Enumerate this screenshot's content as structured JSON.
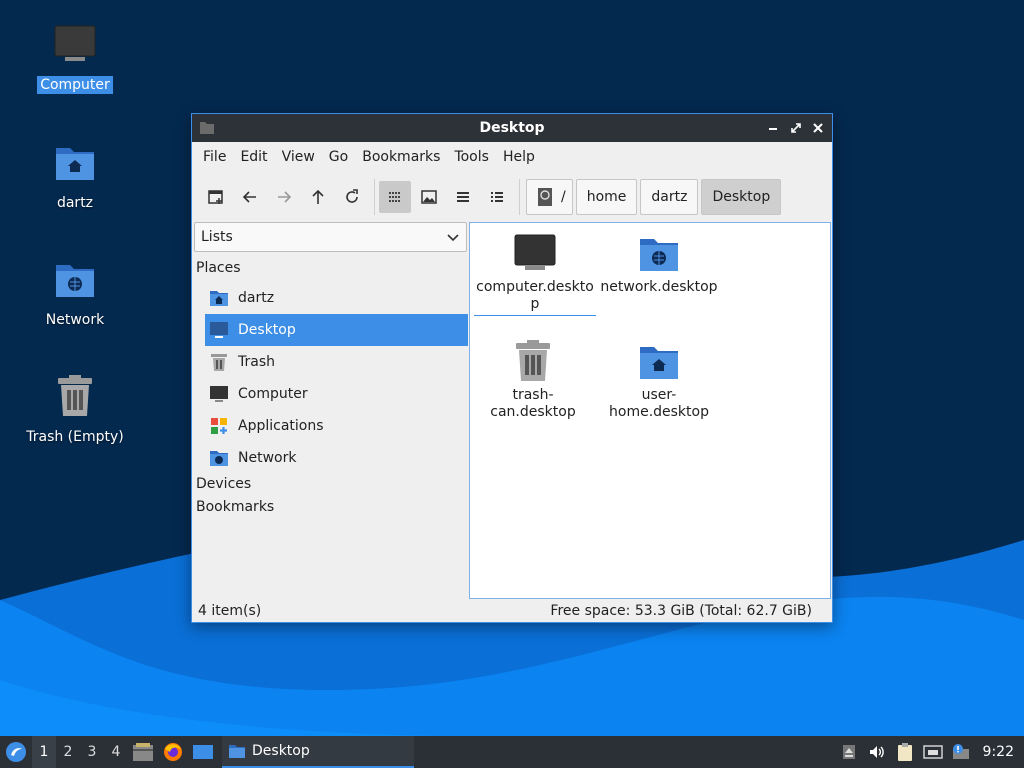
{
  "desktop": {
    "icons": [
      {
        "label": "Computer",
        "icon": "computer-icon",
        "selected": true
      },
      {
        "label": "dartz",
        "icon": "home-folder-icon"
      },
      {
        "label": "Network",
        "icon": "network-folder-icon"
      },
      {
        "label": "Trash (Empty)",
        "icon": "trash-icon"
      }
    ]
  },
  "window": {
    "title": "Desktop",
    "menu": [
      "File",
      "Edit",
      "View",
      "Go",
      "Bookmarks",
      "Tools",
      "Help"
    ],
    "toolbar": {
      "buttons": [
        "new-tab-icon",
        "back-icon",
        "forward-icon",
        "up-icon",
        "reload-icon",
        "icon-view-icon",
        "thumbnail-view-icon",
        "compact-view-icon",
        "detailed-list-icon"
      ],
      "active_view": "icon-view-icon"
    },
    "breadcrumbs": [
      "/",
      "home",
      "dartz",
      "Desktop"
    ],
    "sidepane": {
      "mode": "Lists",
      "places_header": "Places",
      "places": [
        {
          "label": "dartz",
          "icon": "home-folder-icon"
        },
        {
          "label": "Desktop",
          "icon": "desktop-icon",
          "selected": true
        },
        {
          "label": "Trash",
          "icon": "trash-icon"
        },
        {
          "label": "Computer",
          "icon": "computer-icon"
        },
        {
          "label": "Applications",
          "icon": "applications-icon"
        },
        {
          "label": "Network",
          "icon": "network-folder-icon"
        }
      ],
      "devices_header": "Devices",
      "bookmarks_header": "Bookmarks"
    },
    "files": [
      {
        "name": "computer.deskto\np",
        "icon": "computer-icon"
      },
      {
        "name": "network.desktop",
        "icon": "network-folder-icon"
      },
      {
        "name": "trash-\ncan.desktop",
        "icon": "trash-icon"
      },
      {
        "name": "user-\nhome.desktop",
        "icon": "home-folder-icon"
      }
    ],
    "status": {
      "count": "4 item(s)",
      "free_space": "Free space: 53.3 GiB (Total: 62.7 GiB)"
    }
  },
  "taskbar": {
    "workspaces": [
      "1",
      "2",
      "3",
      "4"
    ],
    "active_workspace": "1",
    "launchers": [
      "file-manager-icon",
      "firefox-icon",
      "show-desktop-icon"
    ],
    "task_label": "Desktop",
    "tray": [
      "eject-icon",
      "volume-icon",
      "clipboard-icon",
      "network-icon",
      "update-notifier-icon"
    ],
    "clock": "9:22"
  },
  "colors": {
    "accent": "#3d8ee6",
    "desktop_bg": "#04294f",
    "titlebar": "#2d3238",
    "taskbar": "#2b3036"
  }
}
